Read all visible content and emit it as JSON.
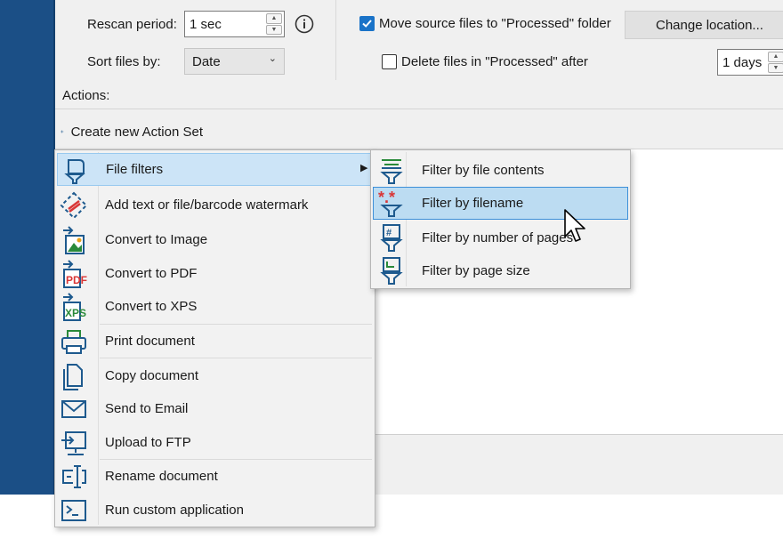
{
  "settings": {
    "rescan_label": "Rescan period:",
    "rescan_value": "1 sec",
    "sort_label": "Sort files by:",
    "sort_value": "Date",
    "move_label": "Move source files to \"Processed\" folder",
    "move_checked": true,
    "change_location_label": "Change location...",
    "delete_label": "Delete files in \"Processed\" after",
    "delete_checked": false,
    "days_value": "1 days"
  },
  "actions": {
    "label": "Actions:",
    "create_label": "Create new Action Set"
  },
  "context_menu": {
    "items": [
      {
        "label": "File filters",
        "icon": "funnel-icon",
        "has_submenu": true
      },
      {
        "label": "Add text or file/barcode watermark",
        "icon": "watermark-icon"
      },
      {
        "label": "Convert to Image",
        "icon": "image-icon"
      },
      {
        "label": "Convert to PDF",
        "icon": "pdf-icon"
      },
      {
        "label": "Convert to XPS",
        "icon": "xps-icon"
      },
      {
        "label": "Print document",
        "icon": "printer-icon"
      },
      {
        "label": "Copy document",
        "icon": "copy-icon"
      },
      {
        "label": "Send to Email",
        "icon": "envelope-icon"
      },
      {
        "label": "Upload to FTP",
        "icon": "ftp-icon"
      },
      {
        "label": "Rename document",
        "icon": "rename-icon"
      },
      {
        "label": "Run custom application",
        "icon": "terminal-icon"
      }
    ]
  },
  "submenu": {
    "items": [
      {
        "label": "Filter by file contents",
        "icon": "filter-contents-icon"
      },
      {
        "label": "Filter by filename",
        "icon": "filter-filename-icon",
        "highlighted": true
      },
      {
        "label": "Filter by number of pages",
        "icon": "filter-pages-icon"
      },
      {
        "label": "Filter by page size",
        "icon": "filter-size-icon"
      }
    ]
  },
  "colors": {
    "sidebar": "#1b4f86",
    "icon_blue": "#1e5a8e",
    "accent_red": "#d93636",
    "accent_green": "#2a8a3a",
    "highlight": "#bcdcf2"
  }
}
